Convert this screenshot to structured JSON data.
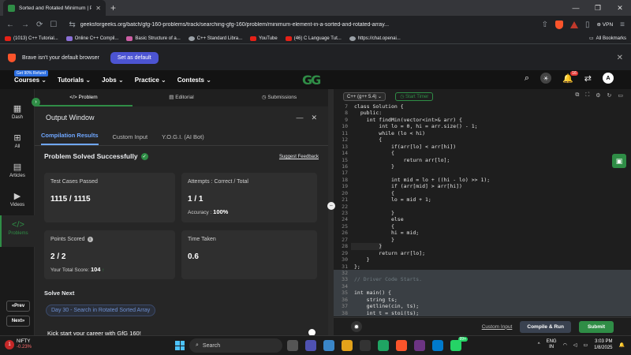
{
  "browser": {
    "tab_title": "Sorted and Rotated Minimum | Pr",
    "url": "geeksforgeeks.org/batch/gfg-160-problems/track/searching-gfg-160/problem/minimum-element-in-a-sorted-and-rotated-array...",
    "vpn_label": "VPN",
    "bookmarks": [
      "(1013) C++ Tutorial...",
      "Online C++ Compil...",
      "Basic Structure of a...",
      "C++ Standard Libra...",
      "YouTube",
      "(46) C Language Tut...",
      "https://chat.openai..."
    ],
    "all_bookmarks": "All Bookmarks",
    "default_msg": "Brave isn't your default browser",
    "set_default": "Set as default"
  },
  "header": {
    "refund_badge": "Get 90% Refund",
    "menu": [
      "Courses",
      "Tutorials",
      "Jobs",
      "Practice",
      "Contests"
    ],
    "logo": "GG",
    "notifications": "16",
    "avatar": "A"
  },
  "rail": {
    "items": [
      "Dash",
      "All",
      "Articles",
      "Videos",
      "Problems"
    ],
    "prev": "Prev",
    "next": "Next"
  },
  "problem_tabs": [
    "Problem",
    "Editorial",
    "Submissions"
  ],
  "output": {
    "title": "Output Window",
    "tabs": [
      "Compilation Results",
      "Custom Input",
      "Y.O.G.I. (AI Bot)"
    ],
    "status": "Problem Solved Successfully",
    "suggest": "Suggest Feedback",
    "test_label": "Test Cases Passed",
    "test_value": "1115 / 1115",
    "attempts_label": "Attempts : Correct / Total",
    "attempts_value": "1 / 1",
    "accuracy_label": "Accuracy :",
    "accuracy_value": "100%",
    "points_label": "Points Scored",
    "points_value": "2 / 2",
    "total_label": "Your Total Score:",
    "total_value": "104",
    "time_label": "Time Taken",
    "time_value": "0.6",
    "solve_next": "Solve Next",
    "next_problem": "Day 30 - Search in Rotated Sorted Array",
    "kick": "Kick start your career with GfG 160!"
  },
  "editor": {
    "language": "C++ (g++ 5.4)",
    "timer": "Start Timer",
    "lines": [
      {
        "n": "7",
        "t": "class Solution {"
      },
      {
        "n": "8",
        "t": "  public:"
      },
      {
        "n": "9",
        "t": "    int findMin(vector<int>& arr) {"
      },
      {
        "n": "10",
        "t": "        int lo = 0, hi = arr.size() - 1;"
      },
      {
        "n": "11",
        "t": "        while (lo < hi)"
      },
      {
        "n": "12",
        "t": "        {"
      },
      {
        "n": "13",
        "t": "            if(arr[lo] < arr[hi])"
      },
      {
        "n": "14",
        "t": "            {"
      },
      {
        "n": "15",
        "t": "                return arr[lo];"
      },
      {
        "n": "16",
        "t": "            }"
      },
      {
        "n": "17",
        "t": ""
      },
      {
        "n": "18",
        "t": "            int mid = lo + ((hi - lo) >> 1);"
      },
      {
        "n": "19",
        "t": "            if (arr[mid] > arr[hi])"
      },
      {
        "n": "20",
        "t": "            {"
      },
      {
        "n": "21",
        "t": "            lo = mid + 1;"
      },
      {
        "n": "22",
        "t": ""
      },
      {
        "n": "23",
        "t": "            }"
      },
      {
        "n": "24",
        "t": "            else"
      },
      {
        "n": "25",
        "t": "            {"
      },
      {
        "n": "26",
        "t": "            hi = mid;"
      },
      {
        "n": "27",
        "t": "            }"
      },
      {
        "n": "28",
        "t": "        }"
      },
      {
        "n": "29",
        "t": "        return arr[lo];"
      },
      {
        "n": "30",
        "t": "    }"
      },
      {
        "n": "31",
        "t": "};"
      },
      {
        "n": "32",
        "t": ""
      },
      {
        "n": "33",
        "t": "// Driver Code Starts."
      },
      {
        "n": "34",
        "t": ""
      },
      {
        "n": "35",
        "t": "int main() {"
      },
      {
        "n": "36",
        "t": "    string ts;"
      },
      {
        "n": "37",
        "t": "    getline(cin, ts);"
      },
      {
        "n": "38",
        "t": "    int t = stoi(ts);"
      }
    ],
    "custom_input": "Custom Input",
    "compile": "Compile & Run",
    "submit": "Submit"
  },
  "taskbar": {
    "nifty": "NIFTY",
    "nifty_change": "-0.23%",
    "search": "Search",
    "lang": "ENG",
    "region": "IN",
    "time": "3:03 PM",
    "date": "1/8/2025",
    "notif_count": "99+"
  }
}
